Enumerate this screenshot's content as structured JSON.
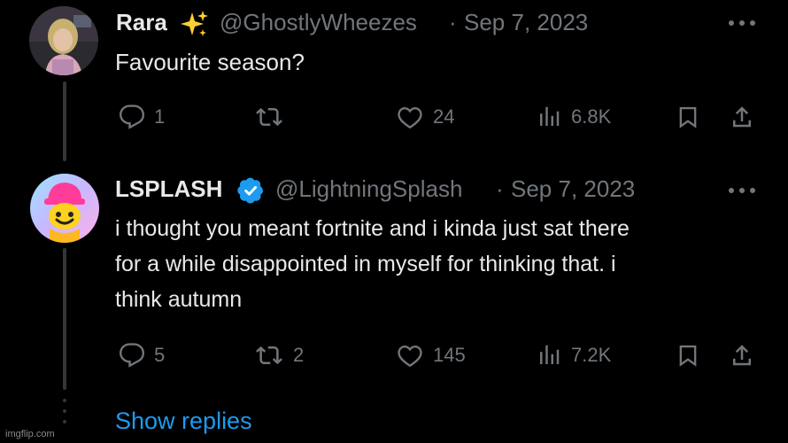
{
  "tweet1": {
    "display_name": "Rara",
    "name_emoji": "✨",
    "handle": "@GhostlyWheezes",
    "separator": "·",
    "date": "Sep 7, 2023",
    "text": "Favourite season?",
    "replies": "1",
    "retweets": "",
    "likes": "24",
    "views": "6.8K"
  },
  "tweet2": {
    "display_name": "LSPLASH",
    "verified": true,
    "handle": "@LightningSplash",
    "separator": "·",
    "date": "Sep 7, 2023",
    "text_lines": [
      "i thought you meant fortnite and i kinda just sat there",
      "for a while disappointed in myself for thinking that. i",
      "think autumn"
    ],
    "replies": "5",
    "retweets": "2",
    "likes": "145",
    "views": "7.2K"
  },
  "show_replies_label": "Show replies",
  "watermark": "imgflip.com",
  "colors": {
    "background": "#000000",
    "text": "#e7e9ea",
    "muted": "#71767b",
    "accent": "#1d9bf0",
    "thread_line": "#333639"
  },
  "icons": [
    "reply-icon",
    "retweet-icon",
    "like-icon",
    "views-icon",
    "bookmark-icon",
    "share-icon",
    "more-icon",
    "verified-badge-icon",
    "sparkles-icon"
  ]
}
